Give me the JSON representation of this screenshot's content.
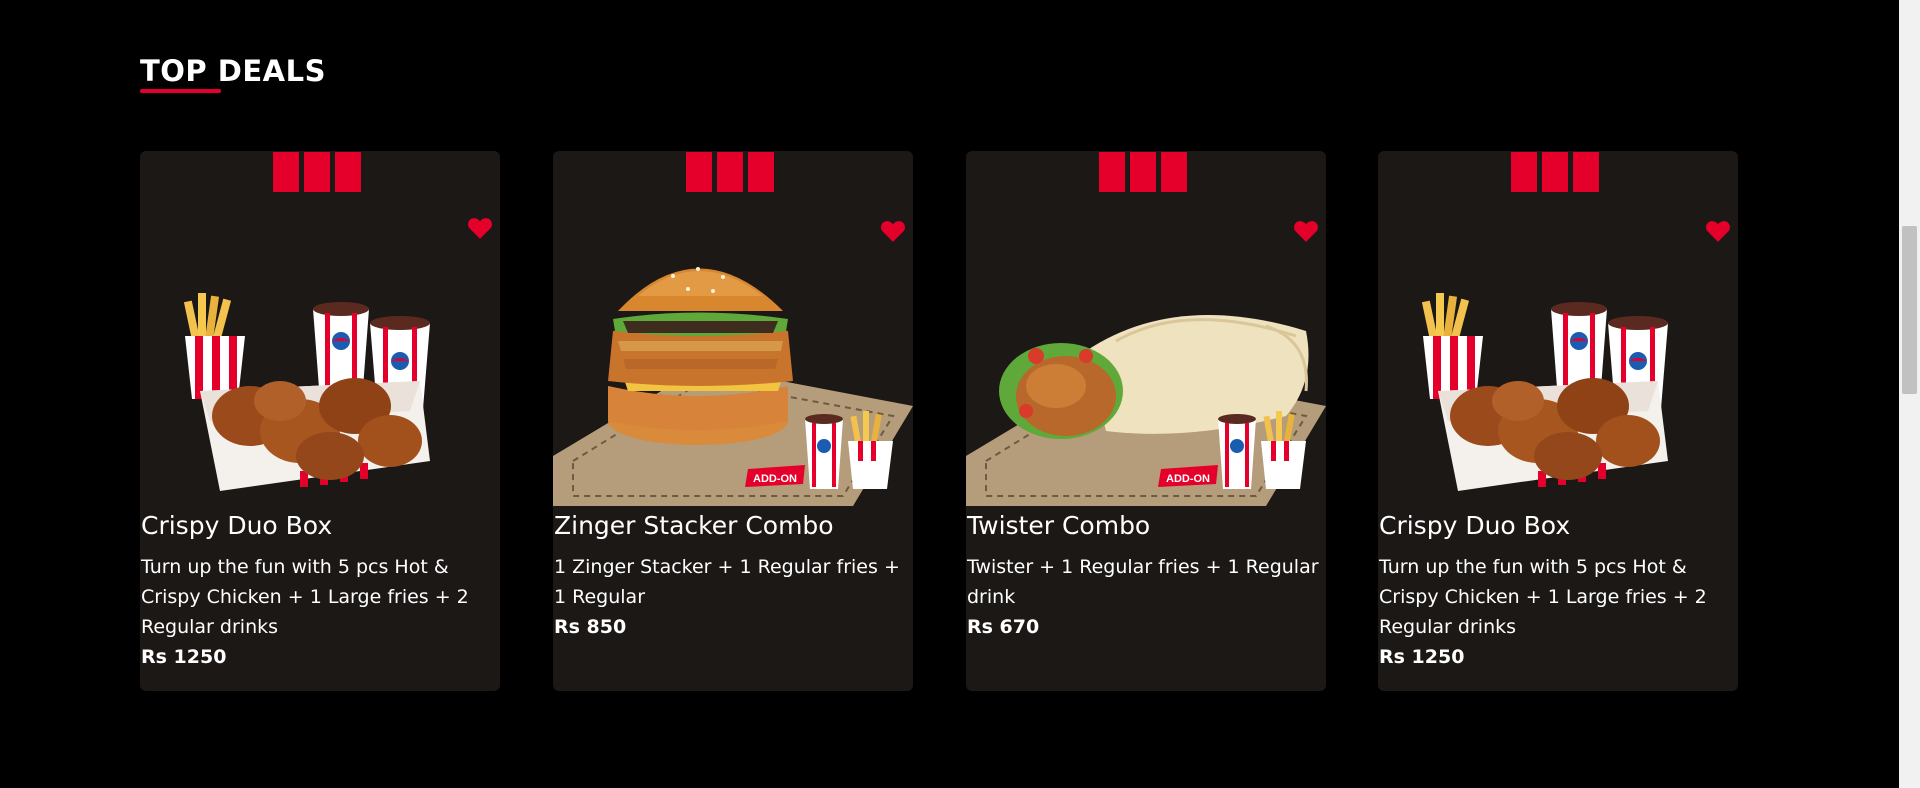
{
  "section": {
    "title": "TOP DEALS"
  },
  "colors": {
    "accent": "#e4002b",
    "card_bg": "#1c1816",
    "page_bg": "#000000"
  },
  "deals": [
    {
      "name": "Crispy Duo Box",
      "description": "Turn up the fun with 5 pcs Hot & Crispy Chicken + 1 Large fries + 2 Regular drinks",
      "price": "Rs 1250",
      "image": "chicken-bucket-meal-image",
      "icon": "heart-icon"
    },
    {
      "name": "Zinger Stacker Combo",
      "description": "1 Zinger Stacker + 1 Regular fries + 1 Regular",
      "price": "Rs 850",
      "image": "burger-combo-image",
      "icon": "heart-icon"
    },
    {
      "name": "Twister Combo",
      "description": "Twister + 1 Regular fries + 1 Regular drink",
      "price": "Rs 670",
      "image": "wrap-combo-image",
      "icon": "heart-icon"
    },
    {
      "name": "Crispy Duo Box",
      "description": "Turn up the fun with 5 pcs Hot & Crispy Chicken + 1 Large fries + 2 Regular drinks",
      "price": "Rs 1250",
      "image": "chicken-bucket-meal-image",
      "icon": "heart-icon"
    }
  ]
}
